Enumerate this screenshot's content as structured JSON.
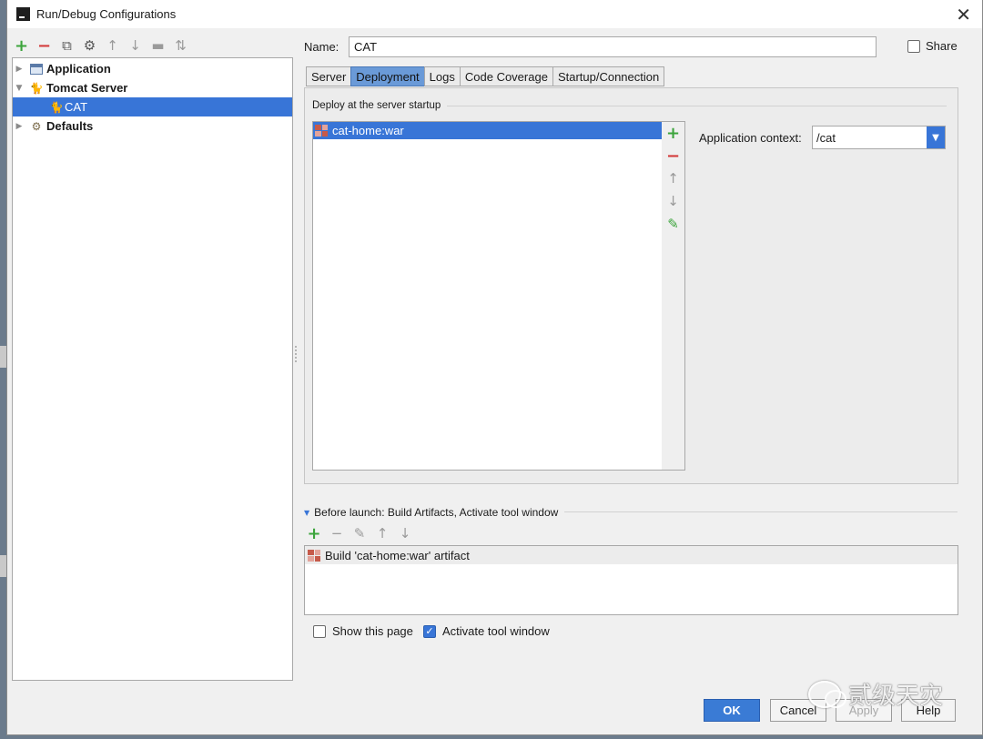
{
  "window": {
    "title": "Run/Debug Configurations"
  },
  "toolbar": {
    "icons": [
      "add-icon",
      "remove-icon",
      "copy-icon",
      "edit-defaults-icon",
      "move-up-icon",
      "move-down-icon",
      "folder-icon",
      "sort-icon"
    ]
  },
  "tree": {
    "items": [
      {
        "label": "Application",
        "expanded": false,
        "bold": true,
        "icon": "application-icon"
      },
      {
        "label": "Tomcat Server",
        "expanded": true,
        "bold": true,
        "icon": "tomcat-icon"
      },
      {
        "label": "CAT",
        "selected": true,
        "icon": "tomcat-config-icon"
      },
      {
        "label": "Defaults",
        "expanded": false,
        "bold": true,
        "icon": "wrench-icon"
      }
    ]
  },
  "config": {
    "name_label": "Name:",
    "name_value": "CAT",
    "share_label": "Share",
    "share_checked": false
  },
  "tabs": [
    {
      "label": "Server",
      "active": false
    },
    {
      "label": "Deployment",
      "active": true
    },
    {
      "label": "Logs",
      "active": false
    },
    {
      "label": "Code Coverage",
      "active": false
    },
    {
      "label": "Startup/Connection",
      "active": false
    }
  ],
  "deployment": {
    "section_title": "Deploy at the server startup",
    "artifacts": [
      {
        "label": "cat-home:war",
        "selected": true
      }
    ],
    "context_label": "Application context:",
    "context_value": "/cat"
  },
  "before_launch": {
    "title": "Before launch: Build Artifacts, Activate tool window",
    "tasks": [
      {
        "label": "Build 'cat-home:war' artifact"
      }
    ]
  },
  "options": {
    "show_page_label": "Show this page",
    "show_page_checked": false,
    "activate_label": "Activate tool window",
    "activate_checked": true
  },
  "buttons": {
    "ok": "OK",
    "cancel": "Cancel",
    "apply": "Apply",
    "help": "Help"
  },
  "watermark": {
    "text": "贰级天灾"
  },
  "colors": {
    "selection": "#3875d7",
    "add": "#3ca43c",
    "remove": "#d33a3a"
  }
}
